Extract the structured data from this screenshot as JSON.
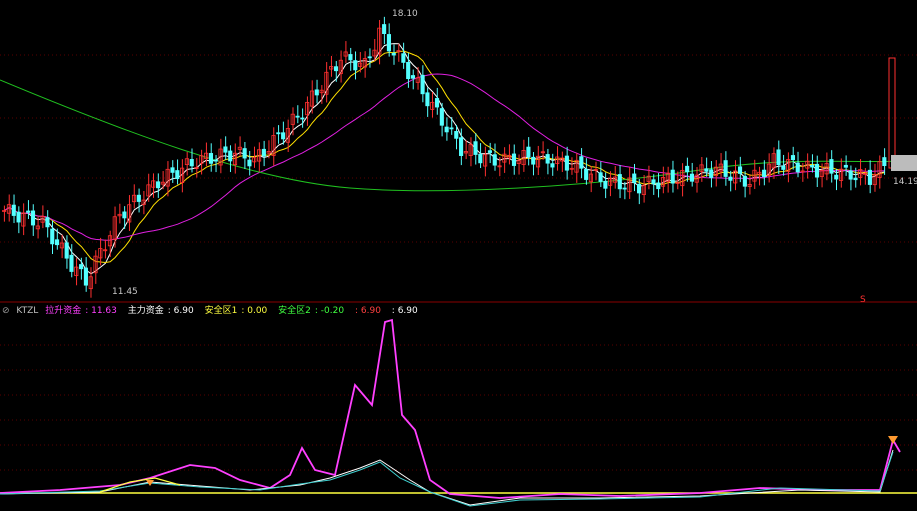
{
  "chart_data": [
    {
      "type": "candlestick",
      "series": [
        {
          "name": "",
          "color": "#ffffff"
        },
        {
          "name": "",
          "color": "#ffe000"
        },
        {
          "name": "",
          "color": "#e020e0"
        },
        {
          "name": "",
          "color": "#20c020"
        }
      ],
      "annotations": {
        "high": "18.10",
        "low": "11.45",
        "last": "14.19",
        "marker": "S"
      },
      "colors": {
        "up": "#ff3030",
        "down": "#54ffff",
        "background": "#000000",
        "grid": "#5a0000"
      }
    },
    {
      "type": "line",
      "indicator": "KTZL",
      "legend": [
        {
          "label": "拉升资金",
          "value": "11.63",
          "color": "#ff40ff"
        },
        {
          "label": "主力资金",
          "value": "6.90",
          "color": "#ffffff"
        },
        {
          "label": "安全区1",
          "value": "0.00",
          "color": "#ffff40"
        },
        {
          "label": "安全区2",
          "value": "-0.20",
          "color": "#40ff40"
        },
        {
          "label": "",
          "value": "6.90",
          "color": "#ff4040"
        },
        {
          "label": "",
          "value": "6.90",
          "color": "#ffffff"
        }
      ]
    }
  ]
}
